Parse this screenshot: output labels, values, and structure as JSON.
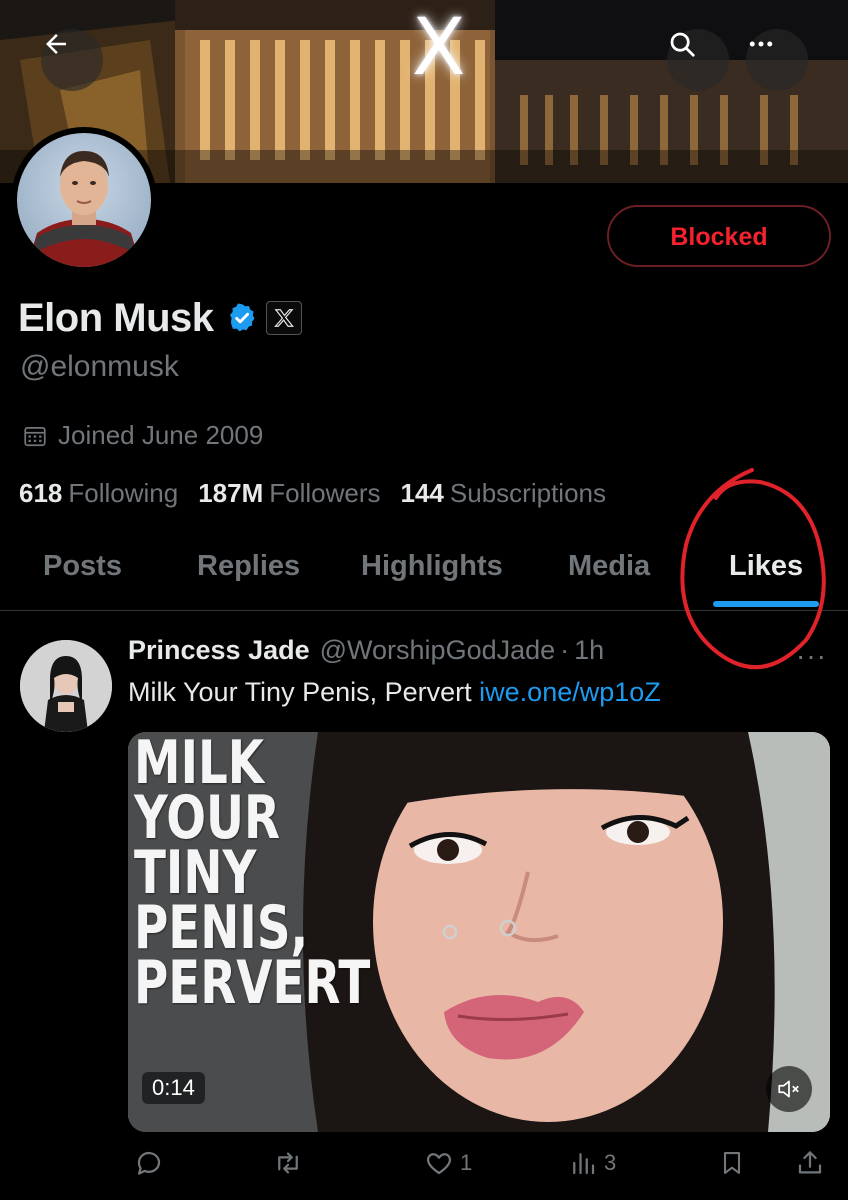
{
  "icons": {
    "back": "arrow-left-icon",
    "search": "search-icon",
    "more": "more-dots-icon",
    "verified": "verified-badge-icon",
    "affiliation": "x-logo-icon",
    "calendar": "calendar-icon",
    "reply": "reply-icon",
    "retweet": "retweet-icon",
    "like": "heart-icon",
    "views": "views-chart-icon",
    "bookmark": "bookmark-icon",
    "share": "share-icon",
    "mute": "speaker-muted-icon"
  },
  "banner": {
    "sign": "X"
  },
  "profile": {
    "name": "Elon Musk",
    "handle": "@elonmusk",
    "joined": "Joined June 2009",
    "blocked_label": "Blocked",
    "stats": {
      "following_count": "618",
      "following_label": "Following",
      "followers_count": "187M",
      "followers_label": "Followers",
      "subscriptions_count": "144",
      "subscriptions_label": "Subscriptions"
    }
  },
  "tabs": [
    {
      "label": "Posts",
      "active": false
    },
    {
      "label": "Replies",
      "active": false
    },
    {
      "label": "Highlights",
      "active": false
    },
    {
      "label": "Media",
      "active": false
    },
    {
      "label": "Likes",
      "active": true
    }
  ],
  "tweet": {
    "name": "Princess Jade",
    "handle": "@WorshipGodJade",
    "separator": "·",
    "time": "1h",
    "more": "···",
    "text": "Milk Your Tiny Penis, Pervert",
    "link": "iwe.one/wp1oZ",
    "media": {
      "overlay_lines": [
        "MILK",
        "YOUR",
        "TINY",
        "PENIS,",
        "PERVERT"
      ],
      "duration": "0:14"
    },
    "likes": "1",
    "views": "3"
  },
  "colors": {
    "accent": "#1d9bf0",
    "blocked": "#f4212e",
    "muted_text": "#71767b",
    "annotation": "#e0222a"
  }
}
